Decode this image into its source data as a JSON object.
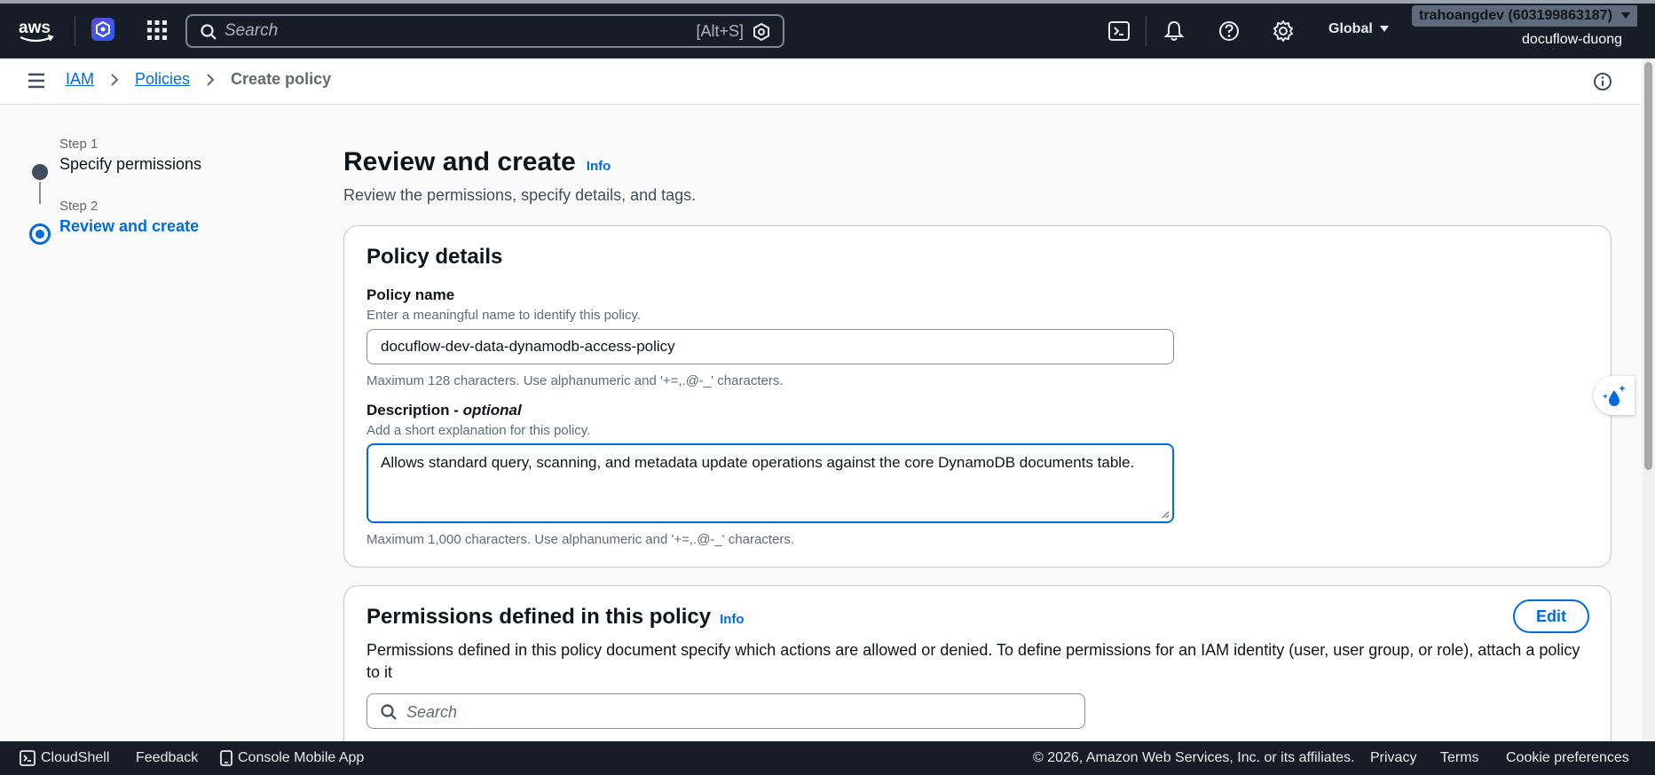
{
  "topnav": {
    "search_placeholder": "Search",
    "search_shortcut": "[Alt+S]",
    "region": "Global",
    "account_tag": "trahoangdev (603199863187)",
    "account_name": "docuflow-duong",
    "icons": [
      "aws-logo-icon",
      "app-badge-icon",
      "services-grid-icon",
      "search-icon",
      "cloudshell-icon",
      "bell-icon",
      "help-icon",
      "settings-icon"
    ]
  },
  "breadcrumb": {
    "items": [
      "IAM",
      "Policies"
    ],
    "current": "Create policy"
  },
  "steps": [
    {
      "caption": "Step 1",
      "title": "Specify permissions"
    },
    {
      "caption": "Step 2",
      "title": "Review and create"
    }
  ],
  "page": {
    "title": "Review and create",
    "info": "Info",
    "description": "Review the permissions, specify details, and tags."
  },
  "policy_details": {
    "heading": "Policy details",
    "name_label": "Policy name",
    "name_desc": "Enter a meaningful name to identify this policy.",
    "name_value": "docuflow-dev-data-dynamodb-access-policy",
    "name_hint": "Maximum 128 characters. Use alphanumeric and '+=,.@-_' characters.",
    "desc_label": "Description - ",
    "desc_optional": "optional",
    "desc_desc": "Add a short explanation for this policy.",
    "desc_value": "Allows standard query, scanning, and metadata update operations against the core DynamoDB documents table.",
    "desc_hint": "Maximum 1,000 characters. Use alphanumeric and '+=,.@-_' characters."
  },
  "permissions": {
    "heading": "Permissions defined in this policy",
    "info": "Info",
    "edit": "Edit",
    "description": "Permissions defined in this policy document specify which actions are allowed or denied. To define permissions for an IAM identity (user, user group, or role), attach a policy to it",
    "search_placeholder": "Search"
  },
  "footer": {
    "cloudshell": "CloudShell",
    "feedback": "Feedback",
    "mobile_app": "Console Mobile App",
    "copyright": "© 2026, Amazon Web Services, Inc. or its affiliates.",
    "privacy": "Privacy",
    "terms": "Terms",
    "cookies": "Cookie preferences"
  },
  "colors": {
    "nav_bg": "#161d26",
    "accent": "#006ce0",
    "page_bg": "#fafafa"
  }
}
